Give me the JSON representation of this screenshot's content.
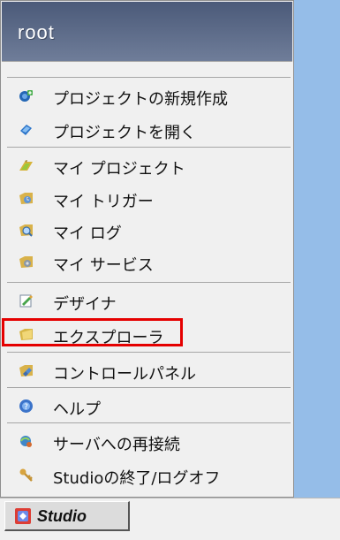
{
  "menu": {
    "header": {
      "title": "root"
    },
    "items": [
      {
        "label": "プロジェクトの新規作成",
        "icon": "new-project-icon"
      },
      {
        "label": "プロジェクトを開く",
        "icon": "open-project-icon"
      },
      {
        "label": "マイ プロジェクト",
        "icon": "my-project-icon"
      },
      {
        "label": "マイ トリガー",
        "icon": "my-trigger-icon"
      },
      {
        "label": "マイ ログ",
        "icon": "my-log-icon"
      },
      {
        "label": "マイ サービス",
        "icon": "my-service-icon"
      },
      {
        "label": "デザイナ",
        "icon": "designer-icon"
      },
      {
        "label": "エクスプローラ",
        "icon": "explorer-icon"
      },
      {
        "label": "コントロールパネル",
        "icon": "control-panel-icon"
      },
      {
        "label": "ヘルプ",
        "icon": "help-icon"
      },
      {
        "label": "サーバへの再接続",
        "icon": "reconnect-icon"
      },
      {
        "label": "Studioの終了/ログオフ",
        "icon": "logoff-icon"
      }
    ],
    "selected_label": "エクスプローラ"
  },
  "taskbar": {
    "studio_button": "Studio",
    "studio_icon": "studio-icon"
  },
  "colors": {
    "header_background": "#5f6d8a",
    "menu_background": "#f0f0f0",
    "highlight_border": "#e50000",
    "desktop_background": "#95bde8"
  }
}
